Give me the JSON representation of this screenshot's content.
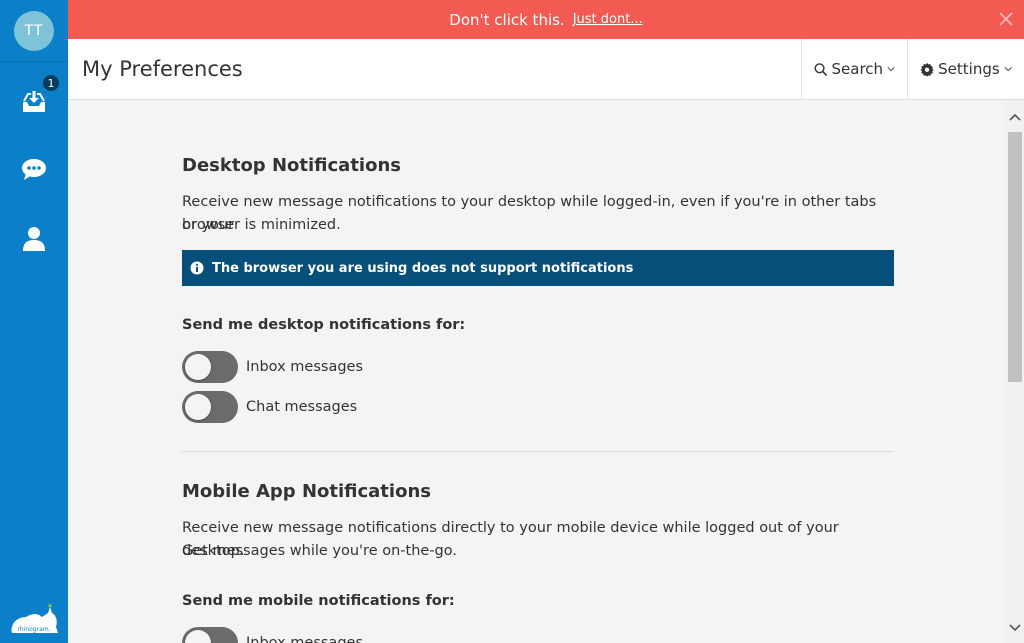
{
  "sidebar": {
    "avatar_initials": "TT",
    "inbox_badge": "1",
    "items": [
      {
        "name": "inbox",
        "icon": "inbox-download-icon"
      },
      {
        "name": "chat",
        "icon": "chat-bubble-icon"
      },
      {
        "name": "contacts",
        "icon": "user-icon"
      }
    ],
    "logo_text": "rhinogram."
  },
  "banner": {
    "message": "Don't click this.",
    "link": "Just dont..."
  },
  "header": {
    "title": "My Preferences",
    "search_label": "Search",
    "settings_label": "Settings"
  },
  "desktop": {
    "title": "Desktop Notifications",
    "description_line1": "Receive new message notifications to your desktop while logged-in, even if you're in other tabs or your",
    "description_line2": "browser is minimized.",
    "info": "The browser you are using does not support notifications",
    "send_label": "Send me desktop notifications for:",
    "toggles": [
      {
        "label": "Inbox messages",
        "on": false
      },
      {
        "label": "Chat messages",
        "on": false
      }
    ]
  },
  "mobile": {
    "title": "Mobile App Notifications",
    "description_line1": "Receive new message notifications directly to your mobile device while logged out of your desktop.",
    "description_line2": "Get messages while you're on-the-go.",
    "send_label": "Send me mobile notifications for:",
    "toggles": [
      {
        "label": "Inbox messages",
        "on": false
      }
    ]
  },
  "colors": {
    "sidebar": "#0b7fc7",
    "banner": "#f25a52",
    "info_bar": "#064f7a",
    "toggle_off": "#6b6b6b"
  }
}
